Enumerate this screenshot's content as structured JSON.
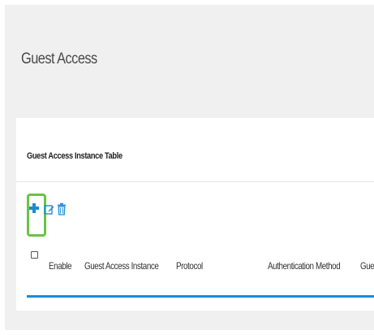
{
  "page": {
    "title": "Guest Access"
  },
  "card": {
    "title": "Guest Access Instance Table"
  },
  "toolbar": {
    "add_icon": "plus-icon",
    "edit_icon": "edit-icon",
    "delete_icon": "trash-icon",
    "highlight_color": "#6ac344",
    "icon_color": "#1c8cd8"
  },
  "table": {
    "columns": [
      "Enable",
      "Guest Access Instance",
      "Protocol",
      "Authentication Method",
      "Gue"
    ],
    "header_rule_color": "#1c8cd8"
  }
}
